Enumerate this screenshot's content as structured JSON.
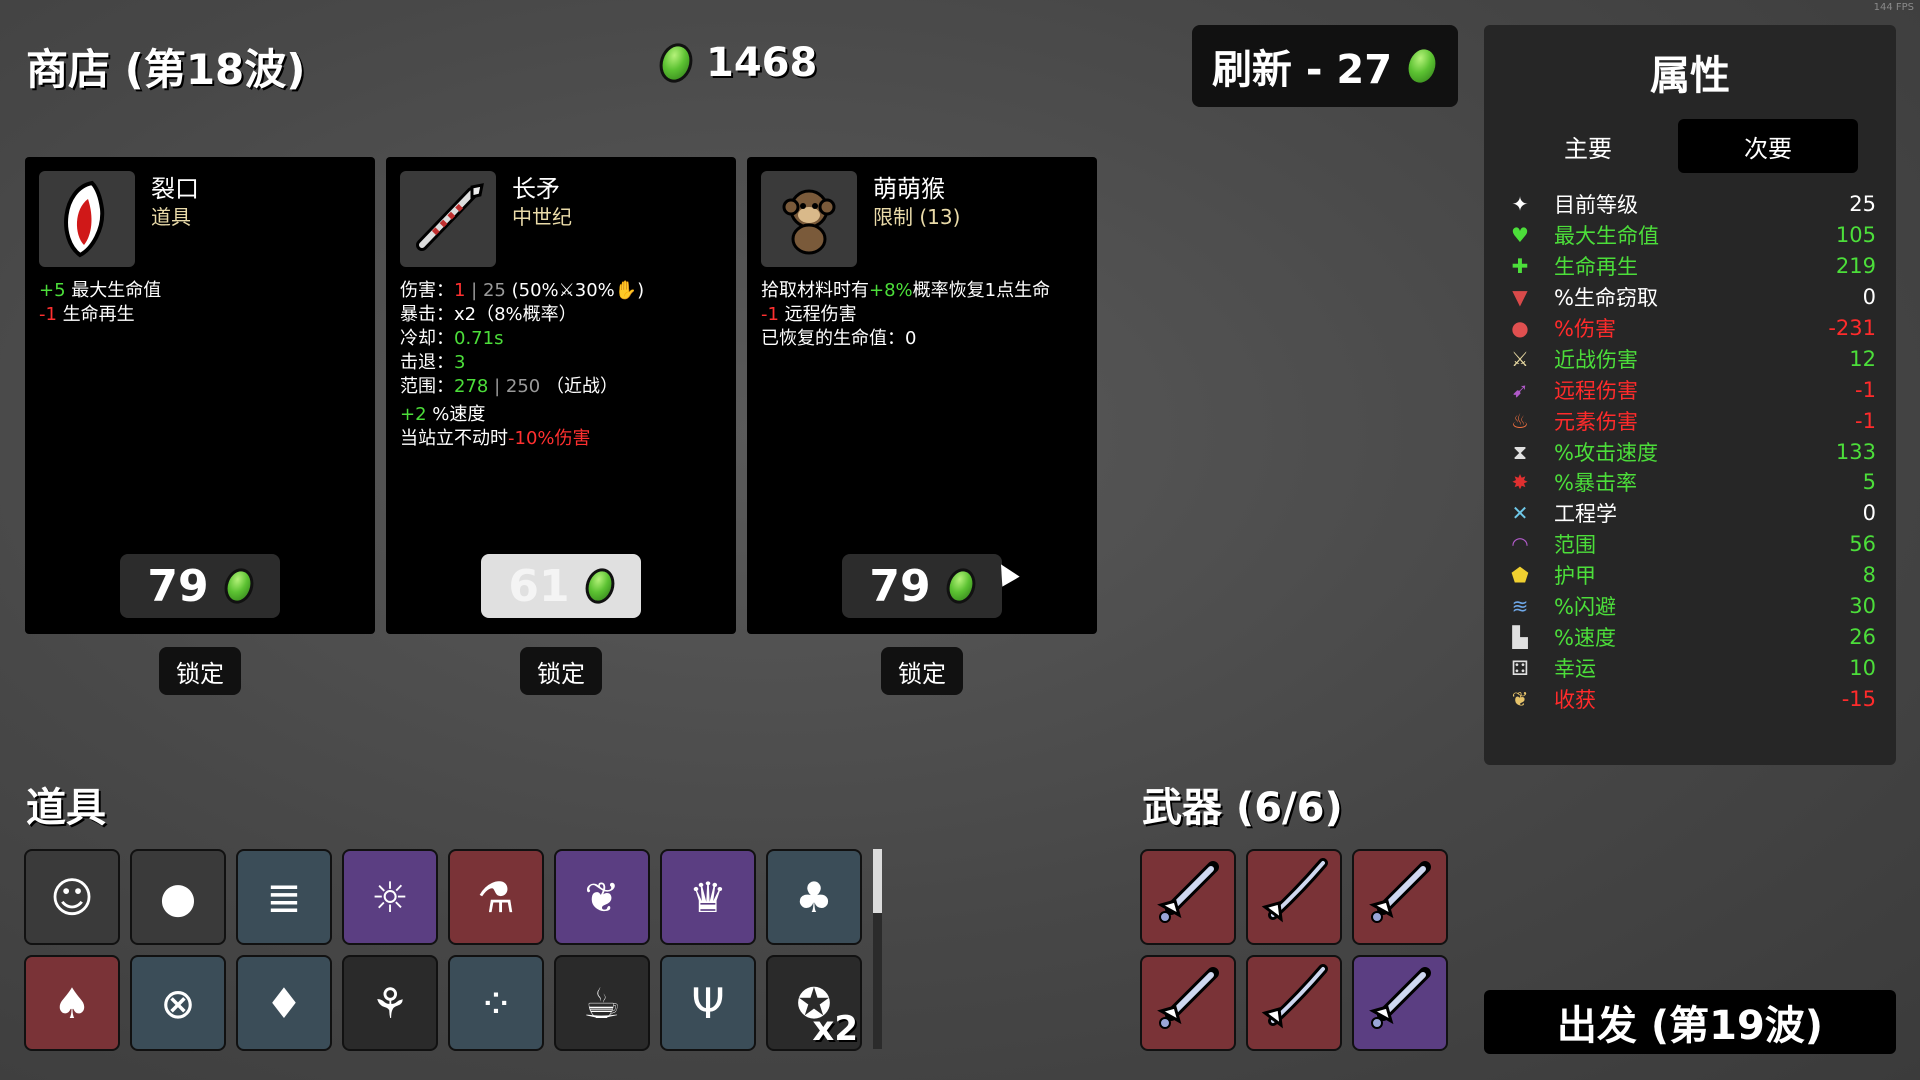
{
  "fps": "144 FPS",
  "shop_title": "商店 (第18波)",
  "gold": "1468",
  "refresh_label": "刷新 - 27",
  "cards": [
    {
      "name": "裂口",
      "type": "道具",
      "price": "79",
      "lock": "锁定"
    },
    {
      "name": "长矛",
      "type": "中世纪",
      "price": "61",
      "lock": "锁定"
    },
    {
      "name": "萌萌猴",
      "type": "限制 (13)",
      "price": "79",
      "lock": "锁定"
    }
  ],
  "card1_desc": {
    "l1v": "+5",
    "l1t": " 最大生命值",
    "l2v": "-1",
    "l2t": " 生命再生"
  },
  "card2_desc": {
    "dmg_label": "伤害：",
    "dmg_v": "1",
    "dmg_sep": " | 25 ",
    "dmg_rest": "(50%⚔30%✋)",
    "crit": "暴击：x2（8%概率）",
    "cd_label": "冷却：",
    "cd_v": "0.71s",
    "kb_label": "击退：",
    "kb_v": "3",
    "range_label": "范围：",
    "range_v": "278",
    "range_sep": " | 250 ",
    "range_rest": "（近战）",
    "spd_v": "+2",
    "spd_t": " %速度",
    "still_t": "当站立不动时",
    "still_v": "-10%伤害"
  },
  "card3_desc": {
    "l1a": "拾取材料时有",
    "l1v": "+8%",
    "l1b": "概率恢复1点生命",
    "l2v": "-1",
    "l2t": " 远程伤害",
    "l3": "已恢复的生命值：0"
  },
  "stats": {
    "title": "属性",
    "tab_primary": "主要",
    "tab_secondary": "次要",
    "rows": [
      {
        "icon": "level-icon",
        "glyph": "✦",
        "label": "目前等级",
        "value": "25",
        "color": "#ffffff",
        "iconColor": "#ffffff"
      },
      {
        "icon": "heart-icon",
        "glyph": "♥",
        "label": "最大生命值",
        "value": "105",
        "color": "#4cde3a",
        "iconColor": "#4cde3a"
      },
      {
        "icon": "heart-plus-icon",
        "glyph": "✚",
        "label": "生命再生",
        "value": "219",
        "color": "#4cde3a",
        "iconColor": "#4cde3a"
      },
      {
        "icon": "fang-icon",
        "glyph": "▼",
        "label": "%生命窃取",
        "value": "0",
        "color": "#ffffff",
        "iconColor": "#d94a4a"
      },
      {
        "icon": "muscle-icon",
        "glyph": "●",
        "label": "%伤害",
        "value": "-231",
        "color": "#ff2b2b",
        "iconColor": "#e05050"
      },
      {
        "icon": "sword-icon",
        "glyph": "⚔",
        "label": "近战伤害",
        "value": "12",
        "color": "#4cde3a",
        "iconColor": "#e6d7a0"
      },
      {
        "icon": "bow-icon",
        "glyph": "➹",
        "label": "远程伤害",
        "value": "-1",
        "color": "#ff2b2b",
        "iconColor": "#b05ac8"
      },
      {
        "icon": "flame-icon",
        "glyph": "♨",
        "label": "元素伤害",
        "value": "-1",
        "color": "#ff2b2b",
        "iconColor": "#f07040"
      },
      {
        "icon": "hourglass-icon",
        "glyph": "⧗",
        "label": "%攻击速度",
        "value": "133",
        "color": "#4cde3a",
        "iconColor": "#e0e0e0"
      },
      {
        "icon": "crit-icon",
        "glyph": "✸",
        "label": "%暴击率",
        "value": "5",
        "color": "#4cde3a",
        "iconColor": "#e03030"
      },
      {
        "icon": "wrench-icon",
        "glyph": "✕",
        "label": "工程学",
        "value": "0",
        "color": "#ffffff",
        "iconColor": "#6fc8e8"
      },
      {
        "icon": "range-icon",
        "glyph": "◠",
        "label": "范围",
        "value": "56",
        "color": "#4cde3a",
        "iconColor": "#b05ac8"
      },
      {
        "icon": "shield-icon",
        "glyph": "⬟",
        "label": "护甲",
        "value": "8",
        "color": "#4cde3a",
        "iconColor": "#f0d030"
      },
      {
        "icon": "dodge-icon",
        "glyph": "≋",
        "label": "%闪避",
        "value": "30",
        "color": "#4cde3a",
        "iconColor": "#6fa8e8"
      },
      {
        "icon": "boot-icon",
        "glyph": "▙",
        "label": "%速度",
        "value": "26",
        "color": "#4cde3a",
        "iconColor": "#e0e0e0"
      },
      {
        "icon": "dice-icon",
        "glyph": "⚃",
        "label": "幸运",
        "value": "10",
        "color": "#4cde3a",
        "iconColor": "#e0e0e0"
      },
      {
        "icon": "wheat-icon",
        "glyph": "❦",
        "label": "收获",
        "value": "-15",
        "color": "#ff2b2b",
        "iconColor": "#e6c36a"
      }
    ]
  },
  "items_title": "道具",
  "items": [
    {
      "icon": "maid-girl-icon",
      "glyph": "☺",
      "bg": "c-gray",
      "qty": ""
    },
    {
      "icon": "money-sack-icon",
      "glyph": "●",
      "bg": "c-gray",
      "qty": ""
    },
    {
      "icon": "caterpillar-icon",
      "glyph": "≣",
      "bg": "c-blue",
      "qty": ""
    },
    {
      "icon": "bunny-icon",
      "glyph": "☼",
      "bg": "c-purple",
      "qty": ""
    },
    {
      "icon": "test-tube-icon",
      "glyph": "⚗",
      "bg": "c-red",
      "qty": ""
    },
    {
      "icon": "wings-icon",
      "glyph": "❦",
      "bg": "c-purple",
      "qty": ""
    },
    {
      "icon": "crowned-girl-icon",
      "glyph": "♛",
      "bg": "c-purple",
      "qty": ""
    },
    {
      "icon": "garden-plot-icon",
      "glyph": "♣",
      "bg": "c-blue",
      "qty": ""
    },
    {
      "icon": "red-hoodie-icon",
      "glyph": "♠",
      "bg": "c-red",
      "qty": ""
    },
    {
      "icon": "black-belt-icon",
      "glyph": "⊗",
      "bg": "c-blue",
      "qty": ""
    },
    {
      "icon": "cat-helmet-icon",
      "glyph": "♦",
      "bg": "c-blue",
      "qty": ""
    },
    {
      "icon": "sprout-icon",
      "glyph": "⚘",
      "bg": "c-dark",
      "qty": ""
    },
    {
      "icon": "spots-icon",
      "glyph": "⁘",
      "bg": "c-blue",
      "qty": ""
    },
    {
      "icon": "coffee-cup-icon",
      "glyph": "☕",
      "bg": "c-dark",
      "qty": ""
    },
    {
      "icon": "claw-icon",
      "glyph": "Ψ",
      "bg": "c-blue",
      "qty": ""
    },
    {
      "icon": "teddy-bear-icon",
      "glyph": "✪",
      "bg": "c-dark",
      "qty": "x2"
    }
  ],
  "weapons_title": "武器 (6/6)",
  "weapons": [
    {
      "icon": "sword-icon",
      "bg": "w-red"
    },
    {
      "icon": "spear-icon",
      "bg": "w-red"
    },
    {
      "icon": "sword-icon",
      "bg": "w-red"
    },
    {
      "icon": "sword-icon",
      "bg": "w-red"
    },
    {
      "icon": "spear-icon",
      "bg": "w-red"
    },
    {
      "icon": "sword-icon",
      "bg": "w-purple"
    }
  ],
  "go_label": "出发 (第19波)"
}
